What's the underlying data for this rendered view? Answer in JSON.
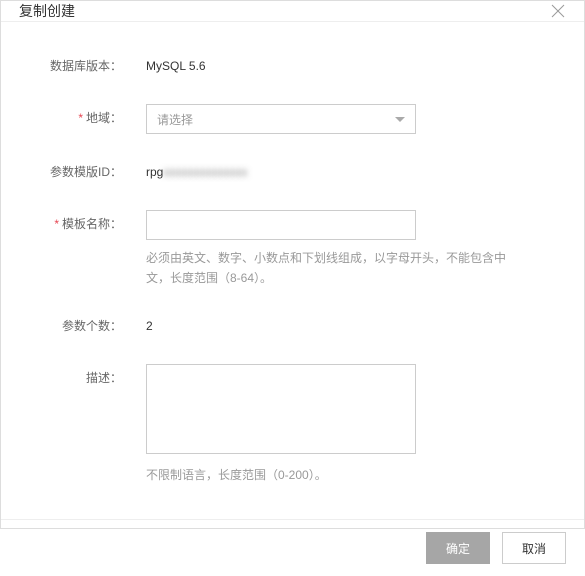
{
  "dialog": {
    "title": "复制创建"
  },
  "form": {
    "db_version": {
      "label": "数据库版本：",
      "value": "MySQL 5.6"
    },
    "region": {
      "label": "地域：",
      "placeholder": "请选择",
      "required": true
    },
    "template_id": {
      "label": "参数模版ID：",
      "value": "rpg"
    },
    "template_name": {
      "label": "模板名称：",
      "value": "",
      "required": true,
      "hint": "必须由英文、数字、小数点和下划线组成，以字母开头，不能包含中文，长度范围（8-64）。"
    },
    "param_count": {
      "label": "参数个数：",
      "value": "2"
    },
    "description": {
      "label": "描述：",
      "value": "",
      "hint": "不限制语言，长度范围（0-200）。"
    }
  },
  "footer": {
    "confirm": "确定",
    "cancel": "取消"
  }
}
